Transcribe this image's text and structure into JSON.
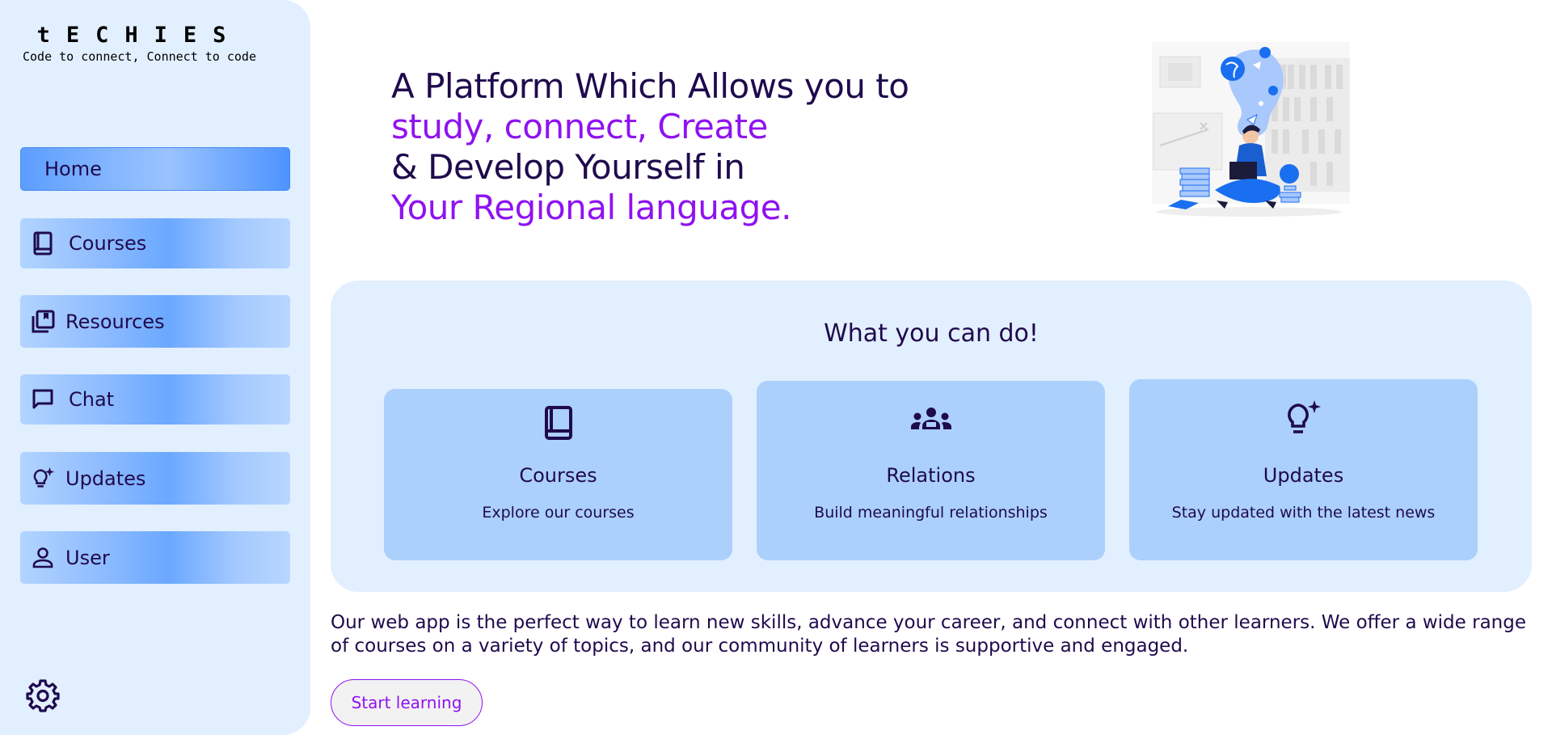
{
  "brand": {
    "title": "tECHIES",
    "tagline": "Code to connect, Connect to code"
  },
  "sidebar": {
    "items": [
      {
        "label": "Home",
        "icon": "home",
        "active": true
      },
      {
        "label": "Courses",
        "icon": "book-icon"
      },
      {
        "label": "Resources",
        "icon": "library-books-icon"
      },
      {
        "label": "Chat",
        "icon": "chat-bubble-icon"
      },
      {
        "label": "Updates",
        "icon": "lightbulb-sparkle-icon"
      },
      {
        "label": "User",
        "icon": "person-icon"
      }
    ],
    "settings_icon": "gear-icon"
  },
  "hero": {
    "line1": "A Platform Which Allows you to",
    "line2": "study, connect, Create",
    "line3": "& Develop Yourself in",
    "line4": "Your Regional language."
  },
  "features": {
    "title": "What you can do!",
    "cards": [
      {
        "icon": "book-icon",
        "title": "Courses",
        "desc": "Explore our courses"
      },
      {
        "icon": "groups-icon",
        "title": "Relations",
        "desc": "Build meaningful relationships"
      },
      {
        "icon": "lightbulb-sparkle-icon",
        "title": "Updates",
        "desc": "Stay updated with the latest news"
      }
    ]
  },
  "blurb": "Our web app is the perfect way to learn new skills, advance your career, and connect with other learners. We offer a wide range of courses on a variety of topics, and our community of learners is supportive and engaged.",
  "cta": {
    "label": "Start learning"
  },
  "colors": {
    "sidebar_bg": "#e2efff",
    "navy_text": "#1f0a4d",
    "accent_purple": "#8f12f0",
    "card_bg": "#abd0fc",
    "nav_blue": "#4d93ff"
  }
}
